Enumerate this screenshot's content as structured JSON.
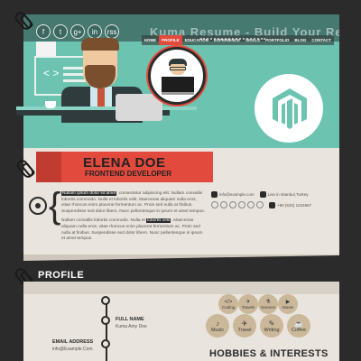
{
  "hero": {
    "brand": "Kuma Resume",
    "tagline": "Kuma Resume - Build Your Resume",
    "social_icons": [
      "f",
      "t",
      "g+",
      "in",
      "rss"
    ],
    "nav": [
      "HOME",
      "PROFILE",
      "EDUCATION",
      "EXPERIENCE",
      "SKILLS",
      "PORTFOLIO",
      "BLOG",
      "CONTACT"
    ],
    "active_nav": "PROFILE"
  },
  "resume": {
    "name": "ELENA DOE",
    "role": "FRONTEND DEVELOPER",
    "bio": {
      "p1_highlight": "Nullam ipsum dolor sit amet",
      "p1_text": ", consectetur adipiscing elit. Nullam convallis lobortis commodo. Nulla et lobortis velit. Maecenas aliquam nulla eros, vitae rhoncus enim placerat fermentum ac. Proin sed nulla at finibus. Suspendisse sed dolor libero. Nunc pellentesque in ipsum et amet tempus.",
      "p2_text_before": "Nullam convallis lobortis commodo. Nulla et ",
      "p2_highlight": "lobortis velit",
      "p2_text_after": ". Maecenas aliquam nulla eros, vitae rhoncus enim placerat fermentum ac. Proin sed nulla at finibus. Suspendisse sed dolor libero. Nunc pellentesque in ipsum et amet tempus."
    },
    "contact": {
      "email": "info@example.com",
      "location": "Live in Istanbul,Turkey",
      "phone": "+90 (532) 1234567"
    }
  },
  "profile": {
    "title": "PROFILE",
    "full_name_label": "FULL NAME",
    "full_name_value": "Kuma Amy Doe",
    "email_label": "EMAIL ADDRESS",
    "email_value": "info@Example.Com"
  },
  "hobbies": {
    "title": "HOBBIES & INTERESTS",
    "items": [
      {
        "icon": "</>",
        "label": "Coding"
      },
      {
        "icon": "✈",
        "label": "Travels"
      },
      {
        "icon": "⚗",
        "label": "Science"
      },
      {
        "icon": "▶",
        "label": "Movie"
      },
      {
        "icon": "♪",
        "label": "Music"
      },
      {
        "icon": "✈",
        "label": "Travel"
      },
      {
        "icon": "✎",
        "label": "Writing"
      },
      {
        "icon": "☕",
        "label": "Coffee"
      }
    ]
  },
  "colors": {
    "accent": "#e14a3c",
    "teal": "#6cc4b0",
    "paper": "#e9e4dd",
    "dark": "#2b2b2b",
    "hobby": "#cbb89a"
  }
}
